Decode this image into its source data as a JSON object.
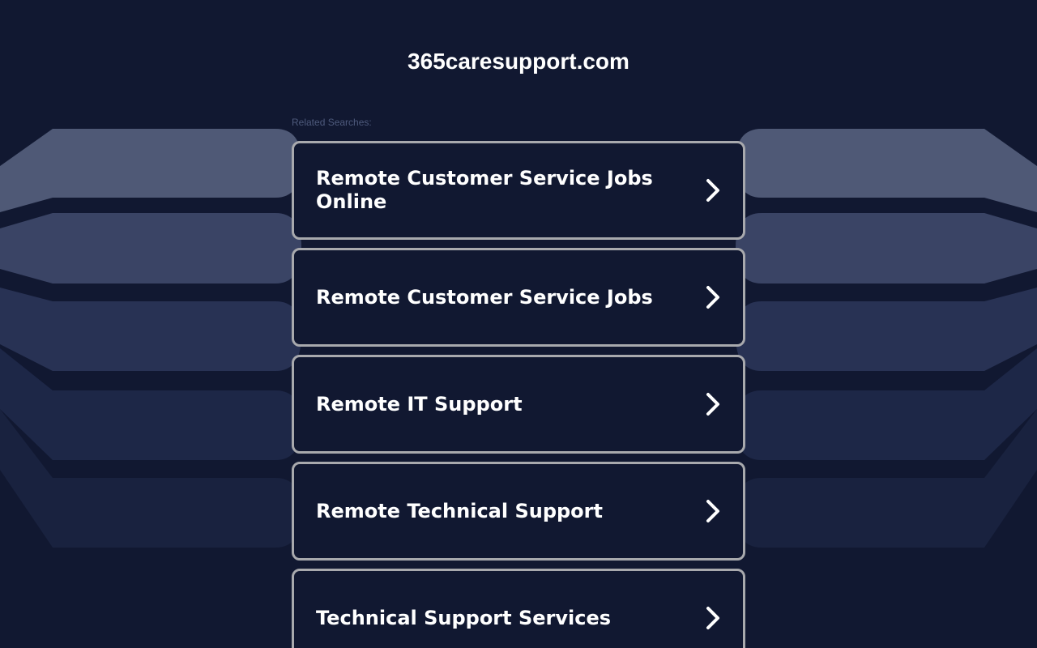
{
  "header": {
    "domain": "365caresupport.com"
  },
  "related": {
    "label": "Related Searches:",
    "items": [
      {
        "label": "Remote Customer Service Jobs Online",
        "icon": "chevron-right-icon"
      },
      {
        "label": "Remote Customer Service Jobs",
        "icon": "chevron-right-icon"
      },
      {
        "label": "Remote IT Support",
        "icon": "chevron-right-icon"
      },
      {
        "label": "Remote Technical Support",
        "icon": "chevron-right-icon"
      },
      {
        "label": "Technical Support Services",
        "icon": "chevron-right-icon"
      }
    ]
  },
  "colors": {
    "background": "#111831",
    "card_border": "#a8a9ad",
    "text": "#ffffff",
    "label": "#4e5a7c"
  }
}
